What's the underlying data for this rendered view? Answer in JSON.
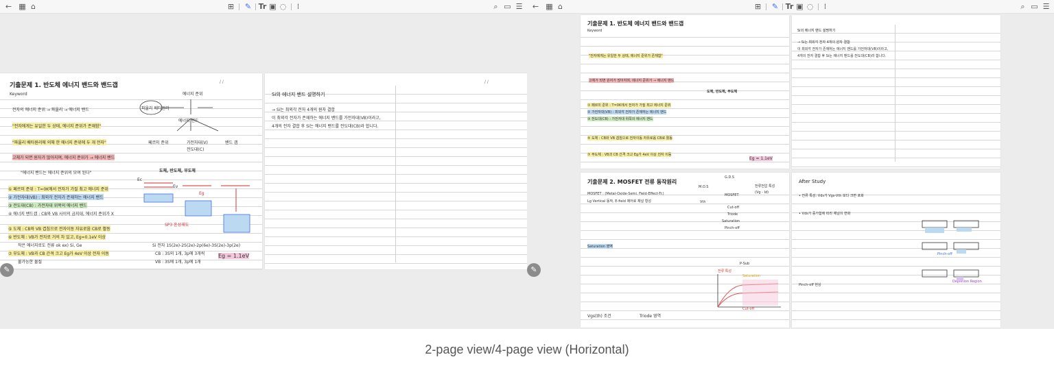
{
  "caption": "2-page view/4-page view (Horizontal)",
  "toolbar": {
    "icons": [
      "back-arrow-icon",
      "thumbnails-icon",
      "bookmark-icon",
      "grid-icon",
      "pen-icon",
      "text-icon",
      "image-icon",
      "lasso-icon",
      "more-icon",
      "search-icon",
      "reader-mode-icon",
      "menu-icon"
    ],
    "text_tool_label": "Tr"
  },
  "pages": {
    "p1": {
      "title": "기출문제 1. 반도체 에너지 밴드와 밴드갭",
      "keyword_label": "Keyword",
      "notes": [
        "전자의 에너지 준위 → 파울리 → 에너지 밴드",
        "\"전자에게는 유일한 두 상태, 에너지 준위가 존재함\"",
        "\"파울리 배타원리에 의해 한 에너지 준위에 두 개 전자\"",
        "고체가 되면 원자가 많아지며, 에너지 준위가 → 에너지 밴드",
        "\"에너지 밴드는 에너지 준위의 모여 된다\"",
        "도체, 반도체, 부도체",
        "① 페르미 준위 : T=0K에서 전자가 가질 최고 에너지 준위",
        "② 가전자대(VB) : 최외각 전자가 존재하는 에너지 밴드",
        "③ 전도대(CB) : 가전자대 위쪽의 에너지 밴드",
        "④ 에너지 밴드갭 : CB와 VB 사이의 금지대, 에너지 준위가 X",
        "⑤ 도체 : CB와 VB 겹침으로 전자이동 자유로움 CB로 활동",
        "⑥ 반도체 : VB가 전자로 거의 차 있고, Eg=0.1eV 이상",
        "작은 에너지로도 전류 ok  ex) Si, Ge",
        "⑦ 부도체 : VB과 CB 간격 크고 Eg가 4eV 이상 전자 이동",
        "불가능한 물질",
        "Si  전자 1S(2e)-2S(2e)-2p(6e)-3S(2e)-3p(2e)",
        "CB : 3S의 1개, 3p에 3개씩",
        "VB : 3S에 1개, 3p에 1개",
        "Eg = 1.1eV",
        "SP3 혼성궤도",
        "에너지 준위",
        "에너지 밴드",
        "파울리 배타원리",
        "페르미 준위",
        "가전자대(V)",
        "전도대(C)",
        "밴드 갭",
        "Ec",
        "Ev",
        "Eg"
      ]
    },
    "p2": {
      "title": "Si의 에너지 밴드 설명하기",
      "notes": [
        "→ Si는 최외각 전자 4개의 원자 결합",
        "이 최외각 전자가 존재하는 에너지 밴드를 가전자대(VB)이라고,",
        "4개의 전자 결합 후 Si는 에너지 밴드를 전도대(CB)라 합니다."
      ]
    },
    "p3": {
      "title": "기출문제 2. MOSFET 전류 동작원리",
      "notes": [
        "MOSFET : (Metal-Oxide-Semi. Field-Effect-Tr.)",
        "Lg Vertical 동작, E-field 제어로 채널 형성",
        "G.D.S",
        "M.O.S",
        "MOSFET",
        "전류전압 특성",
        "(Vg - Id)",
        "Vth",
        "Cut-off",
        "Triode",
        "Saturation",
        "Pinch-off",
        "전류 특성",
        "Cut-off",
        "Saturation",
        "P-Sub",
        "Id",
        "Vds",
        "Ids",
        "Vgs",
        "Vd",
        "Vs",
        "증가형(Default-off)",
        "공핍형(Default-on)",
        "Vgs(th) 조건",
        "Triode 영역",
        "Saturation 영역"
      ]
    },
    "p4": {
      "title": "After Study",
      "notes": [
        "• 전류 특성: Vds가 Vgs-Vth 보다 크면 포화",
        "• Vds가 증가함에 따라 채널이 변화",
        "Pinch-off 현상",
        "Pinch-off",
        "Depletion Region"
      ]
    }
  },
  "page_numbers": "/ /"
}
